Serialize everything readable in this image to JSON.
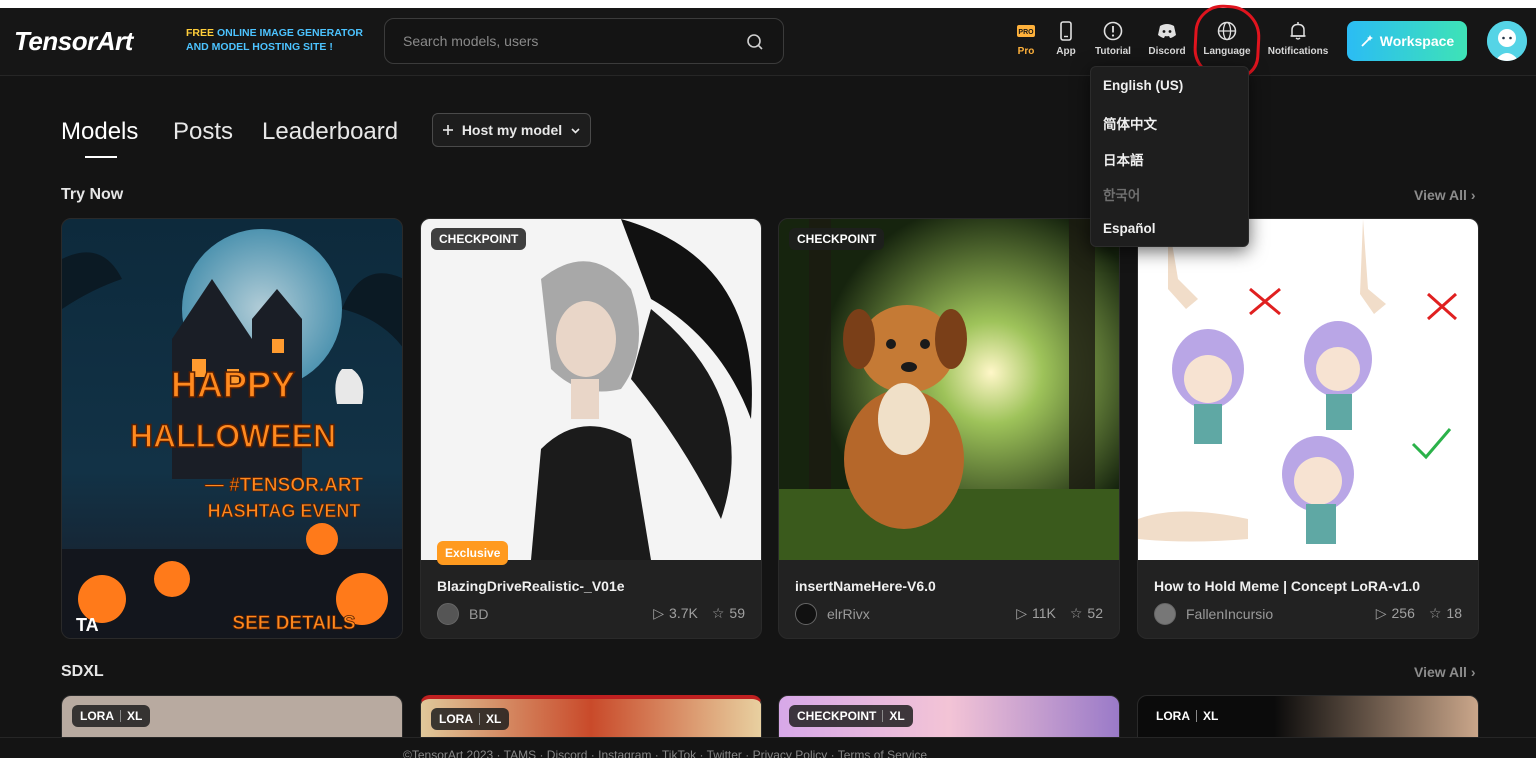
{
  "header": {
    "logo_main": "TensorArt",
    "tagline_free": "FREE",
    "tagline_line1": "ONLINE IMAGE GENERATOR",
    "tagline_line2": "AND MODEL HOSTING SITE !",
    "search_placeholder": "Search models, users",
    "nav": [
      {
        "label": "Pro",
        "icon": "pro-icon"
      },
      {
        "label": "App",
        "icon": "phone-icon"
      },
      {
        "label": "Tutorial",
        "icon": "info-icon"
      },
      {
        "label": "Discord",
        "icon": "discord-icon"
      },
      {
        "label": "Language",
        "icon": "globe-icon"
      },
      {
        "label": "Notifications",
        "icon": "bell-icon"
      }
    ],
    "workspace_label": "Workspace"
  },
  "language_menu": [
    "English (US)",
    "简体中文",
    "日本語",
    "한국어",
    "Español"
  ],
  "tabs": [
    "Models",
    "Posts",
    "Leaderboard"
  ],
  "host_button": "Host my model",
  "sections": [
    {
      "title": "Try Now",
      "view_all": "View All"
    },
    {
      "title": "SDXL",
      "view_all": "View All"
    }
  ],
  "try_now_cards": [
    {
      "banner": true,
      "banner_lines": [
        "HAPPY",
        "HALLOWEEN",
        "— #TENSOR.ART",
        "HASHTAG EVENT",
        "SEE DETAILS"
      ],
      "banner_mark": "TA"
    },
    {
      "badge": "CHECKPOINT",
      "exclusive": "Exclusive",
      "title": "BlazingDriveRealistic-_V01e",
      "author": "BD",
      "runs": "3.7K",
      "stars": "59"
    },
    {
      "badge": "CHECKPOINT",
      "title": "insertNameHere-V6.0",
      "author": "elrRivx",
      "runs": "11K",
      "stars": "52"
    },
    {
      "title": "How to Hold Meme | Concept LoRA-v1.0",
      "author": "FallenIncursio",
      "runs": "256",
      "stars": "18"
    }
  ],
  "sdxl_cards": [
    {
      "badge_a": "LORA",
      "badge_b": "XL"
    },
    {
      "badge_a": "LORA",
      "badge_b": "XL"
    },
    {
      "badge_a": "CHECKPOINT",
      "badge_b": "XL"
    },
    {
      "badge_a": "LORA",
      "badge_b": "XL"
    }
  ],
  "footer_text": "©TensorArt 2023  ·  TAMS  ·  Discord  ·  Instagram  ·  TikTok  ·  Twitter  ·  Privacy Policy  ·  Terms of Service",
  "colors": {
    "background": "#141414",
    "accent_workspace_from": "#2bbcf4",
    "accent_workspace_to": "#3ee3b6",
    "pro": "#ffb13b",
    "exclusive": "#ff9a1f",
    "annotation_red": "#e0141e"
  }
}
